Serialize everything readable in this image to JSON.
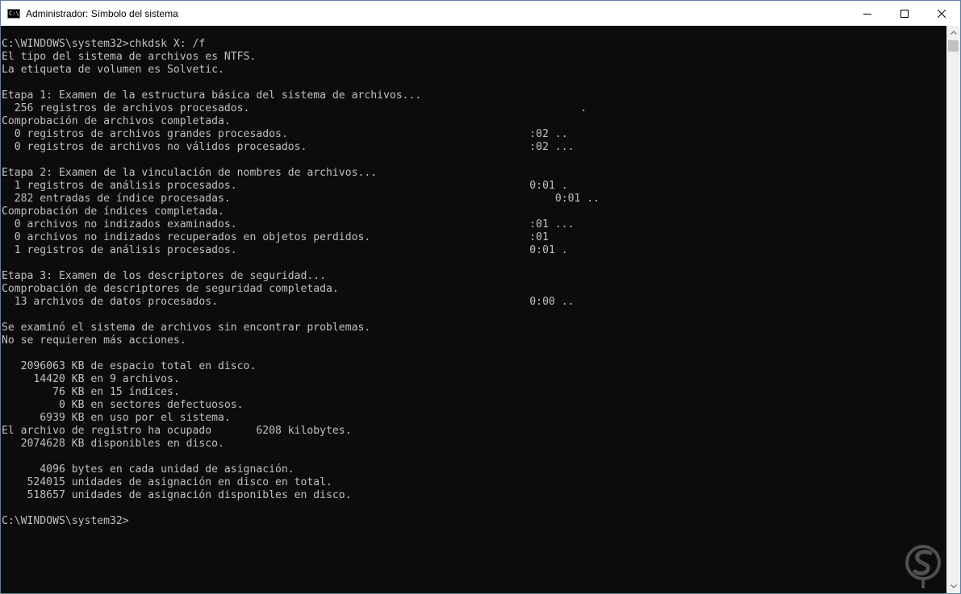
{
  "window": {
    "title": "Administrador: Símbolo del sistema",
    "icon": "console-icon",
    "icon_glyph": "C:\\",
    "controls": [
      "minimize-icon",
      "maximize-icon",
      "close-icon"
    ]
  },
  "console": {
    "lines": [
      "C:\\WINDOWS\\system32>chkdsk X: /f",
      "El tipo del sistema de archivos es NTFS.",
      "La etiqueta de volumen es Solvetic.",
      "",
      "Etapa 1: Examen de la estructura básica del sistema de archivos...",
      "  256 registros de archivos procesados.                                                    .",
      "Comprobación de archivos completada.",
      "  0 registros de archivos grandes procesados.                                      :02 ..",
      "  0 registros de archivos no válidos procesados.                                   :02 ...",
      "",
      "Etapa 2: Examen de la vinculación de nombres de archivos...",
      "  1 registros de análisis procesados.                                              0:01 .",
      "  282 entradas de índice procesadas.                                                   0:01 ..",
      "Comprobación de índices completada.",
      "  0 archivos no indizados examinados.                                              :01 ...",
      "  0 archivos no indizados recuperados en objetos perdidos.                         :01",
      "  1 registros de análisis procesados.                                              0:01 .",
      "",
      "Etapa 3: Examen de los descriptores de seguridad...",
      "Comprobación de descriptores de seguridad completada.",
      "  13 archivos de datos procesados.                                                 0:00 ..",
      "",
      "Se examinó el sistema de archivos sin encontrar problemas.",
      "No se requieren más acciones.",
      "",
      "   2096063 KB de espacio total en disco.",
      "     14420 KB en 9 archivos.",
      "        76 KB en 15 índices.",
      "         0 KB en sectores defectuosos.",
      "      6939 KB en uso por el sistema.",
      "El archivo de registro ha ocupado       6208 kilobytes.",
      "   2074628 KB disponibles en disco.",
      "",
      "      4096 bytes en cada unidad de asignación.",
      "    524015 unidades de asignación en disco en total.",
      "    518657 unidades de asignación disponibles en disco.",
      "",
      "C:\\WINDOWS\\system32>"
    ]
  },
  "scrollbar": {
    "up_icon": "scroll-up-arrow-icon",
    "down_icon": "scroll-down-arrow-icon"
  },
  "watermark": {
    "icon": "solvetic-logo-icon"
  },
  "colors": {
    "console_bg": "#0c0c0c",
    "console_fg": "#c0c0c0",
    "titlebar_bg": "#ffffff",
    "scrollbar_bg": "#f0f0f0",
    "scrollbar_thumb": "#c1c1c1"
  }
}
